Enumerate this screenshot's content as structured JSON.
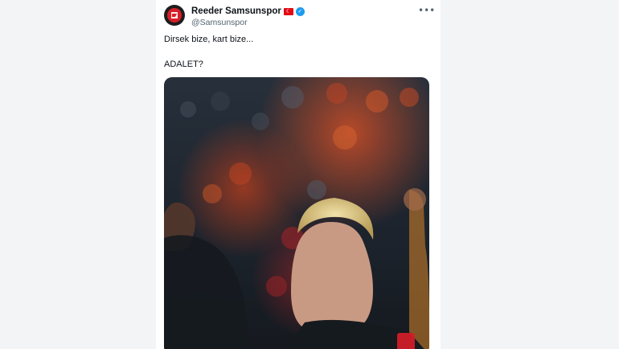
{
  "tweet": {
    "display_name": "Reeder Samsunspor",
    "handle": "@Samsunspor",
    "text_line1": "Dirsek bize, kart bize...",
    "text_line2": "ADALET?",
    "flag_icon": "turkey-flag-icon",
    "verified_icon": "verified-badge-icon",
    "more_icon": "more-options-icon",
    "verified_color": "#1d9bf0",
    "brand_color": "#d71e28"
  },
  "media": {
    "description_icon": "football-player-photo"
  }
}
